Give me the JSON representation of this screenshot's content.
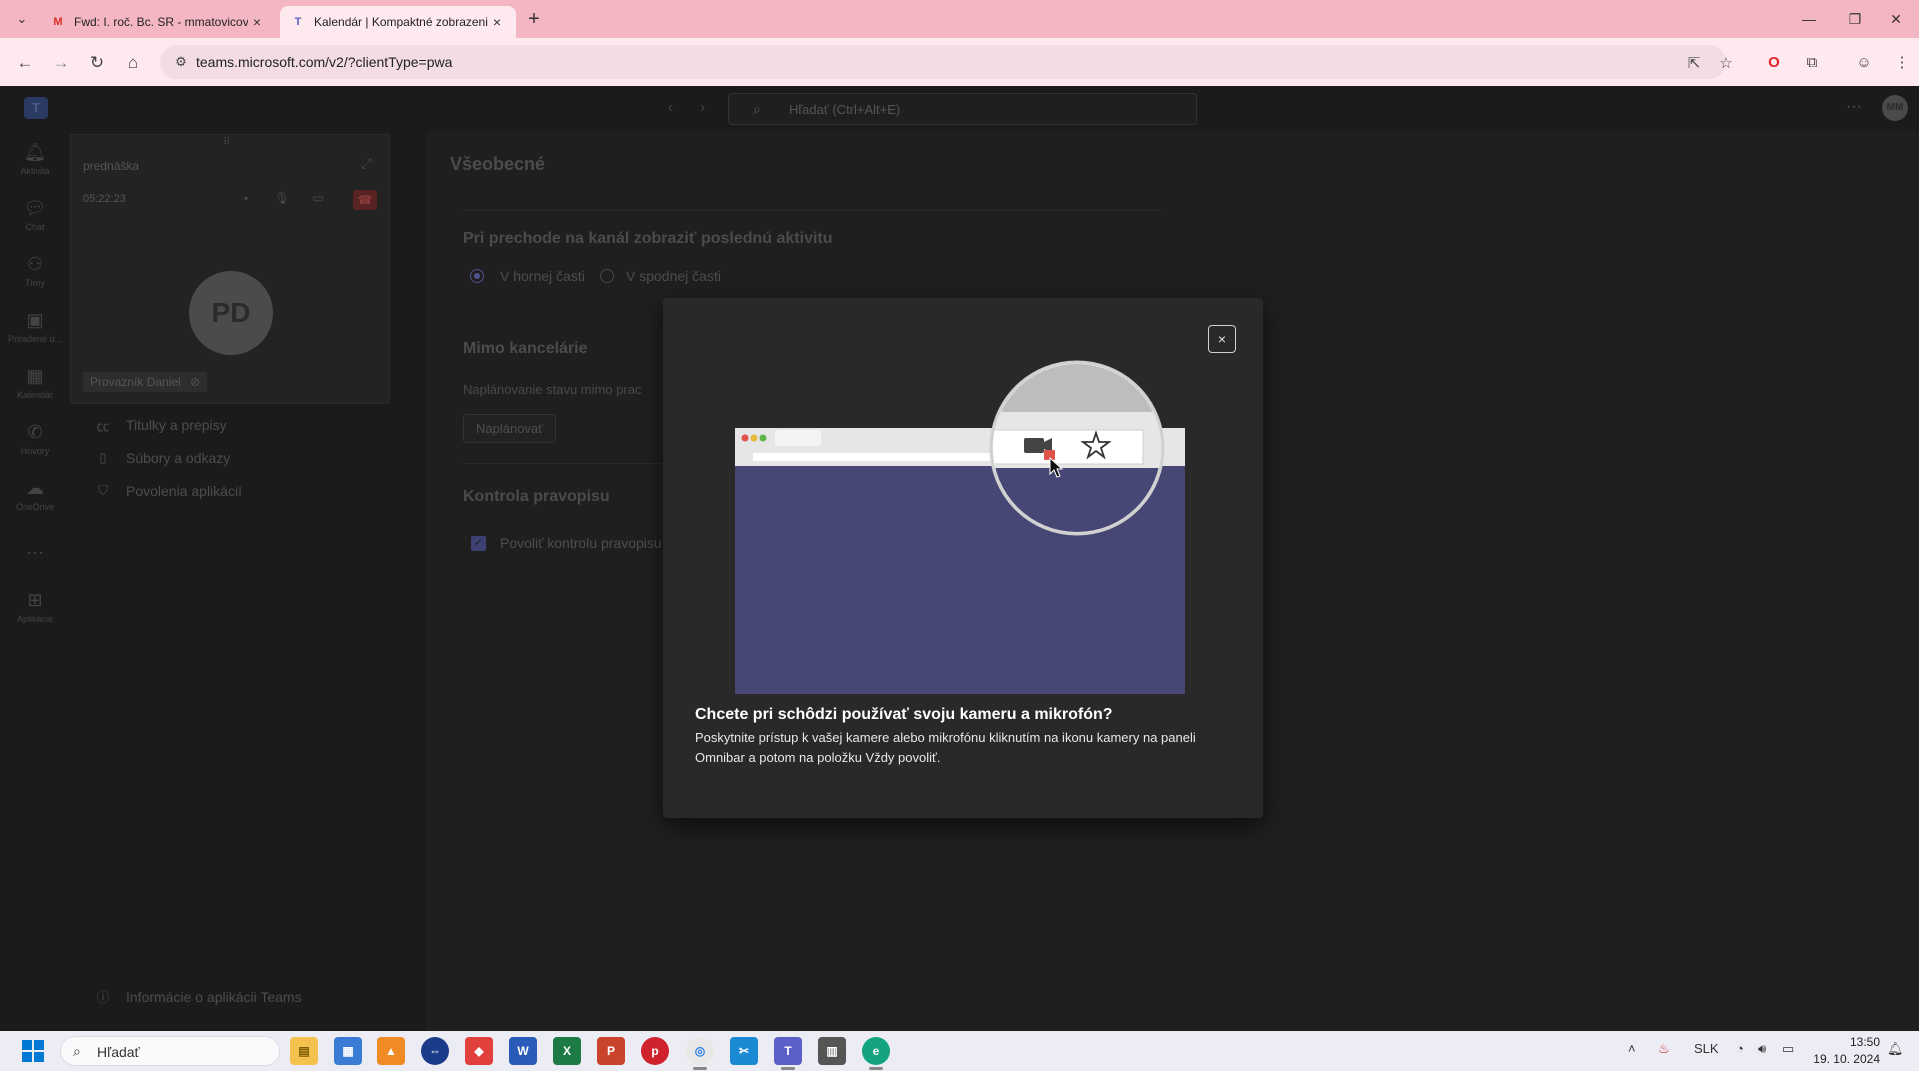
{
  "browser": {
    "tabs": [
      {
        "title": "Fwd: I. roč. Bc. SR - mmatovicova@",
        "icon": "gmail-icon",
        "active": false
      },
      {
        "title": "Kalendár | Kompaktné zobrazenie",
        "icon": "teams-icon",
        "active": true
      }
    ],
    "url": "teams.microsoft.com/v2/?clientType=pwa"
  },
  "teams": {
    "search_placeholder": "Hľadať (Ctrl+Alt+E)",
    "user_initials": "MM",
    "rail": [
      {
        "label": "Aktivita",
        "icon": "bell-icon"
      },
      {
        "label": "Chat",
        "icon": "chat-icon"
      },
      {
        "label": "Tímy",
        "icon": "teams-people-icon"
      },
      {
        "label": "Priradené ú...",
        "icon": "backpack-icon"
      },
      {
        "label": "Kalendár",
        "icon": "calendar-icon"
      },
      {
        "label": "Hovory",
        "icon": "phone-icon"
      },
      {
        "label": "OneDrive",
        "icon": "cloud-icon"
      },
      {
        "label": "Aplikácie",
        "icon": "add-app-icon"
      }
    ],
    "more_label": "···"
  },
  "call": {
    "title": "prednáška",
    "duration": "05:22:23",
    "participant_initials": "PD",
    "participant_name": "Provazník Daniel"
  },
  "settings_menu": {
    "items": [
      "Titulky a prepisy",
      "Súbory a odkazy",
      "Povolenia aplikácií"
    ],
    "about": "Informácie o aplikácii Teams"
  },
  "main": {
    "title": "Všeobecné",
    "channel_section_title": "Pri prechode na kanál zobraziť poslednú aktivitu",
    "radio_top": "V hornej časti",
    "radio_bottom": "V spodnej časti",
    "ooo_title": "Mimo kancelárie",
    "ooo_text": "Naplánovanie stavu mimo prac",
    "ooo_button": "Naplánovať",
    "spell_title": "Kontrola pravopisu",
    "spell_checkbox": "Povoliť kontrolu pravopisu"
  },
  "modal": {
    "heading": "Chcete pri schôdzi používať svoju kameru a mikrofón?",
    "body": "Poskytnite prístup k vašej kamere alebo mikrofónu kliknutím na ikonu kamery na paneli Omnibar a potom na položku Vždy povoliť.",
    "close_label": "×"
  },
  "taskbar": {
    "search_label": "Hľadať",
    "language": "SLK",
    "time": "13:50",
    "date": "19. 10. 2024",
    "apps": [
      "file-explorer-icon",
      "store-icon",
      "vlc-icon",
      "teamviewer-icon",
      "anydesk-icon",
      "word-icon",
      "excel-icon",
      "powerpoint-icon",
      "pinterest-icon",
      "chrome-icon",
      "snipping-icon",
      "teams-icon",
      "notepad-icon",
      "edge-icon"
    ]
  },
  "colors": {
    "tab_bar": "#f5b6c3",
    "toolbar": "#fde9ee",
    "app_bg": "#1f1f1f",
    "modal_bg": "#292929",
    "illustration_window": "#464775"
  }
}
